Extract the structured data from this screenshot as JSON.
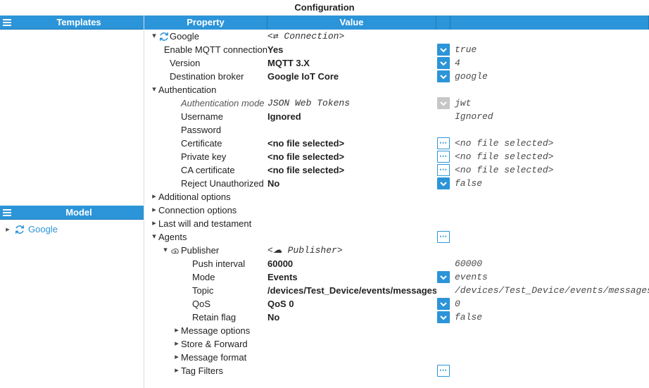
{
  "title": "Configuration",
  "left_panels": {
    "templates": {
      "header": "Templates"
    },
    "model": {
      "header": "Model",
      "root": {
        "label": "Google",
        "icon": "sync-icon"
      }
    }
  },
  "grid_head": {
    "property": "Property",
    "value": "Value"
  },
  "rows": [
    {
      "indent": 0,
      "expander": "▾",
      "icon": "sync",
      "label": "Google",
      "value": "<⇄ Connection>",
      "value_style": "val-mono"
    },
    {
      "indent": 1,
      "label": "Enable MQTT connection",
      "value": "Yes",
      "btn": "dd",
      "extra": "true"
    },
    {
      "indent": 1,
      "label": "Version",
      "value": "MQTT 3.X",
      "btn": "dd",
      "extra": "4"
    },
    {
      "indent": 1,
      "label": "Destination broker",
      "value": "Google IoT Core",
      "btn": "dd",
      "extra": "google"
    },
    {
      "indent": 0,
      "expander": "▾",
      "label": "Authentication",
      "group": true
    },
    {
      "indent": 2,
      "label": "Authentication mode",
      "label_style": "prop-italic",
      "value": "JSON Web Tokens",
      "value_style": "val-mono",
      "btn": "dd-disabled",
      "extra": "jwt"
    },
    {
      "indent": 2,
      "label": "Username",
      "value": "Ignored",
      "extra": "Ignored"
    },
    {
      "indent": 2,
      "label": "Password"
    },
    {
      "indent": 2,
      "label": "Certificate",
      "value": "<no file selected>",
      "btn": "dots",
      "extra": "<no file selected>"
    },
    {
      "indent": 2,
      "label": "Private key",
      "value": "<no file selected>",
      "btn": "dots",
      "extra": "<no file selected>"
    },
    {
      "indent": 2,
      "label": "CA certificate",
      "value": "<no file selected>",
      "btn": "dots",
      "extra": "<no file selected>"
    },
    {
      "indent": 2,
      "label": "Reject Unauthorized",
      "value": "No",
      "btn": "dd",
      "extra": "false"
    },
    {
      "indent": 0,
      "expander": "▸",
      "label": "Additional options",
      "group": true
    },
    {
      "indent": 0,
      "expander": "▸",
      "label": "Connection options",
      "group": true
    },
    {
      "indent": 0,
      "expander": "▸",
      "label": "Last will and testament",
      "group": true
    },
    {
      "indent": 0,
      "expander": "▾",
      "label": "Agents",
      "group": true,
      "btn": "dots"
    },
    {
      "indent": 1,
      "expander": "▾",
      "icon": "cloud",
      "label": "Publisher",
      "value": "<☁ Publisher>",
      "value_style": "val-mono"
    },
    {
      "indent": 3,
      "label": "Push interval",
      "value": "60000",
      "extra": "60000"
    },
    {
      "indent": 3,
      "label": "Mode",
      "value": "Events",
      "btn": "dd",
      "extra": "events"
    },
    {
      "indent": 3,
      "label": "Topic",
      "value": "/devices/Test_Device/events/messages",
      "extra": "/devices/Test_Device/events/messages"
    },
    {
      "indent": 3,
      "label": "QoS",
      "value": "QoS 0",
      "btn": "dd",
      "extra": "0"
    },
    {
      "indent": 3,
      "label": "Retain flag",
      "value": "No",
      "btn": "dd",
      "extra": "false"
    },
    {
      "indent": 2,
      "expander": "▸",
      "label": "Message options",
      "group": true
    },
    {
      "indent": 2,
      "expander": "▸",
      "label": "Store & Forward",
      "group": true
    },
    {
      "indent": 2,
      "expander": "▸",
      "label": "Message format",
      "group": true
    },
    {
      "indent": 2,
      "expander": "▸",
      "label": "Tag Filters",
      "group": true,
      "btn": "dots"
    }
  ]
}
